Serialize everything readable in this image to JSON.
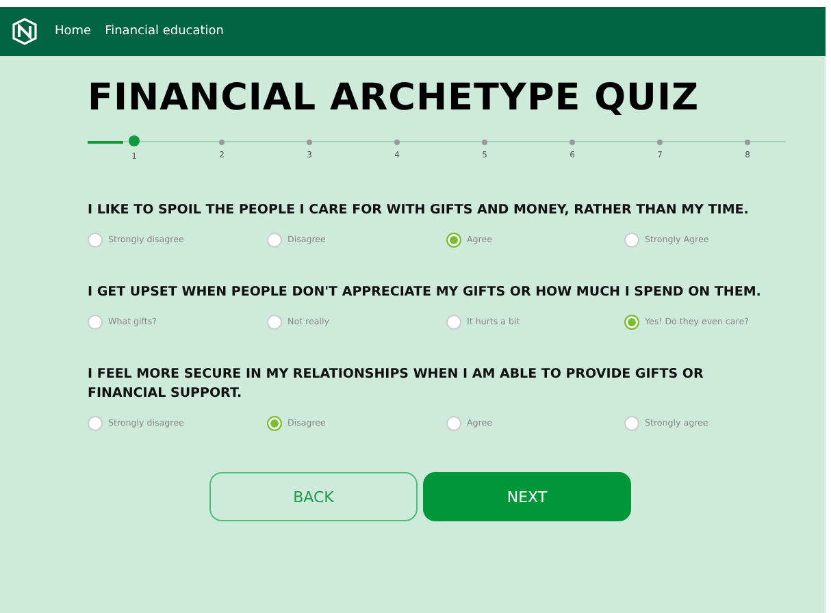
{
  "nav": {
    "links": [
      "Home",
      "Financial education"
    ]
  },
  "title": "FINANCIAL ARCHETYPE QUIZ",
  "steps": [
    {
      "label": "1",
      "selected": true
    },
    {
      "label": "2",
      "selected": false
    },
    {
      "label": "3",
      "selected": false
    },
    {
      "label": "4",
      "selected": false
    },
    {
      "label": "5",
      "selected": false
    },
    {
      "label": "6",
      "selected": false
    },
    {
      "label": "7",
      "selected": false
    },
    {
      "label": "8",
      "selected": false
    }
  ],
  "questions": [
    {
      "text": "I LIKE TO SPOIL THE PEOPLE I CARE FOR WITH GIFTS AND MONEY, RATHER THAN MY TIME.",
      "options": [
        {
          "label": "Strongly disagree",
          "selected": false
        },
        {
          "label": "Disagree",
          "selected": false
        },
        {
          "label": "Agree",
          "selected": true
        },
        {
          "label": "Strongly Agree",
          "selected": false
        }
      ]
    },
    {
      "text": "I GET UPSET WHEN PEOPLE DON'T APPRECIATE MY GIFTS OR HOW MUCH I SPEND ON THEM.",
      "options": [
        {
          "label": "What gifts?",
          "selected": false
        },
        {
          "label": "Not really",
          "selected": false
        },
        {
          "label": "It hurts a bit",
          "selected": false
        },
        {
          "label": "Yes! Do they even care?",
          "selected": true
        }
      ]
    },
    {
      "text": "I FEEL MORE SECURE IN MY RELATIONSHIPS WHEN I AM ABLE TO PROVIDE GIFTS OR FINANCIAL SUPPORT.",
      "options": [
        {
          "label": "Strongly disagree",
          "selected": false
        },
        {
          "label": "Disagree",
          "selected": true
        },
        {
          "label": "Agree",
          "selected": false
        },
        {
          "label": "Strongly agree",
          "selected": false
        }
      ]
    }
  ],
  "buttons": {
    "back": "BACK",
    "next": "NEXT"
  }
}
